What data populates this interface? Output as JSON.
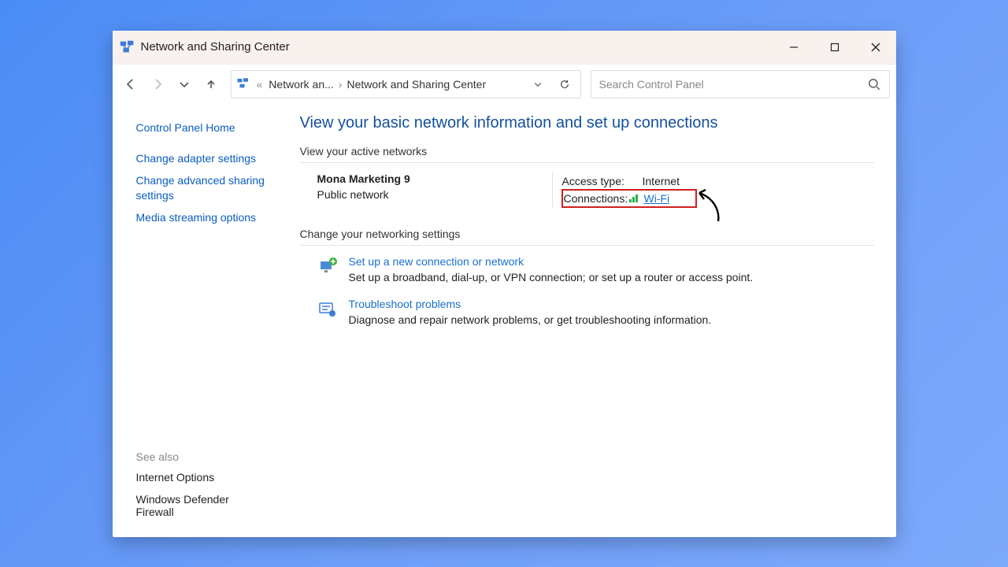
{
  "titlebar": {
    "title": "Network and Sharing Center"
  },
  "address": {
    "crumb1": "Network an...",
    "crumb2": "Network and Sharing Center"
  },
  "search": {
    "placeholder": "Search Control Panel"
  },
  "sidebar": {
    "home": "Control Panel Home",
    "links": [
      "Change adapter settings",
      "Change advanced sharing settings",
      "Media streaming options"
    ],
    "see_also_label": "See also",
    "see_also": [
      "Internet Options",
      "Windows Defender Firewall"
    ]
  },
  "main": {
    "heading": "View your basic network information and set up connections",
    "active_label": "View your active networks",
    "network": {
      "name": "Mona Marketing 9",
      "category": "Public network",
      "access_label": "Access type:",
      "access_value": "Internet",
      "conn_label": "Connections:",
      "conn_value": "Wi-Fi"
    },
    "change_label": "Change your networking settings",
    "tasks": [
      {
        "title": "Set up a new connection or network",
        "desc": "Set up a broadband, dial-up, or VPN connection; or set up a router or access point."
      },
      {
        "title": "Troubleshoot problems",
        "desc": "Diagnose and repair network problems, or get troubleshooting information."
      }
    ]
  }
}
